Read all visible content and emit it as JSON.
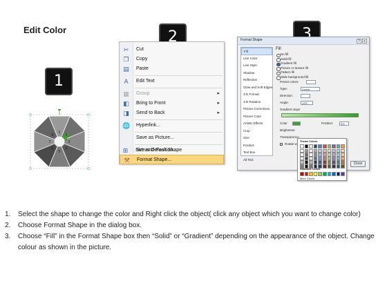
{
  "title": "Edit Color",
  "badges": [
    "1",
    "2",
    "3"
  ],
  "octagon": {
    "center_numbers": [
      "1",
      "2",
      "3",
      "4",
      "5",
      "6",
      "7",
      "8"
    ],
    "colors": [
      "#9a9a9a",
      "#6f6f6f",
      "#8a8a8a",
      "#5a5a5a",
      "#7c7c7c",
      "#4a4a4a",
      "#949494",
      "#646464"
    ],
    "highlight_color": "#3da12b"
  },
  "context_menu": {
    "items": [
      {
        "label": "Cut",
        "icon": "scissors-icon",
        "disabled": false
      },
      {
        "label": "Copy",
        "icon": "copy-icon",
        "disabled": false
      },
      {
        "label": "Paste",
        "icon": "paste-icon",
        "disabled": false
      },
      {
        "label": "Edit Text",
        "icon": "edit-text-icon",
        "disabled": false
      },
      {
        "label": "Group",
        "icon": "group-icon",
        "disabled": true
      },
      {
        "label": "Bring to Front",
        "icon": "bring-front-icon",
        "disabled": false
      },
      {
        "label": "Send to Back",
        "icon": "send-back-icon",
        "disabled": false
      },
      {
        "label": "Hyperlink...",
        "icon": "hyperlink-icon",
        "disabled": false
      },
      {
        "label": "Save as Picture...",
        "icon": "",
        "disabled": false
      },
      {
        "label": "Set as Default Shape",
        "icon": "",
        "disabled": false
      },
      {
        "label": "Size and Position...",
        "icon": "size-icon",
        "disabled": false
      },
      {
        "label": "Format Shape...",
        "icon": "format-shape-icon",
        "disabled": false
      }
    ],
    "highlighted": "Format Shape..."
  },
  "dialog": {
    "title": "Format Shape",
    "window_buttons": [
      "?",
      "x"
    ],
    "nav_items": [
      "Fill",
      "Line Color",
      "Line Style",
      "Shadow",
      "Reflection",
      "Glow and Soft Edges",
      "3-D Format",
      "3-D Rotation",
      "Picture Corrections",
      "Picture Color",
      "Artistic Effects",
      "Crop",
      "Size",
      "Position",
      "Text Box",
      "Alt Text"
    ],
    "selected_nav": "Fill",
    "panel_heading": "Fill",
    "fill_options": [
      "No fill",
      "Solid fill",
      "Gradient fill",
      "Picture or texture fill",
      "Pattern fill",
      "Slide background fill"
    ],
    "selected_fill": "Gradient fill",
    "props": {
      "preset_label": "Preset colors:",
      "type_label": "Type:",
      "type_value": "Linear",
      "direction_label": "Direction:",
      "angle_label": "Angle:",
      "angle_value": "225°",
      "stops_label": "Gradient stops",
      "color_label": "Color",
      "position_label": "Position:",
      "position_value": "0%",
      "brightness_label": "Brightness:",
      "transparency_label": "Transparency:",
      "rotate_label": "Rotate with shape"
    },
    "close_label": "Close"
  },
  "color_picker": {
    "theme_label": "Theme Colors",
    "standard_label": "Standard Colors",
    "more_label": "More Colors...",
    "theme_top": [
      "#ffffff",
      "#000000",
      "#eeece1",
      "#1f497d",
      "#4f81bd",
      "#c0504d",
      "#9bbb59",
      "#8064a2",
      "#4bacc6",
      "#f79646"
    ],
    "standard": [
      "#c00000",
      "#ff0000",
      "#ffc000",
      "#ffff00",
      "#92d050",
      "#00b050",
      "#00b0f0",
      "#0070c0",
      "#002060",
      "#7030a0"
    ]
  },
  "instructions": [
    {
      "num": "1.",
      "text": "Select the shape to change the color and Right click the object( click any object which you want to change color)"
    },
    {
      "num": "2.",
      "text": "Choose Format Shape in the dialog box."
    },
    {
      "num": "3.",
      "text": "Choose “Fill” in the Format Shape box then “Solid” or “Gradient” depending on the appearance of the object. Change colour as shown in the picture."
    }
  ]
}
